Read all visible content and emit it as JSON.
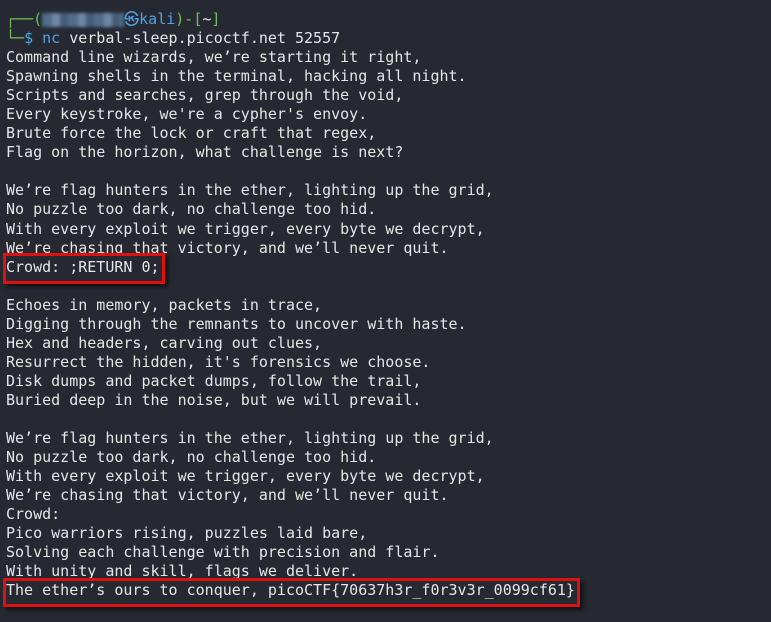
{
  "prompt": {
    "corner_top": "┌──(",
    "user_redacted": true,
    "at_symbol": "㉿",
    "host": "kali",
    "close_paren": ")-[",
    "dir": "~",
    "close_bracket": "]",
    "corner_bottom": "└─",
    "dollar": "$",
    "command": "nc",
    "args": "verbal-sleep.picoctf.net 52557"
  },
  "output_lines": [
    "Command line wizards, we’re starting it right,",
    "Spawning shells in the terminal, hacking all night.",
    "Scripts and searches, grep through the void,",
    "Every keystroke, we're a cypher's envoy.",
    "Brute force the lock or craft that regex,",
    "Flag on the horizon, what challenge is next?",
    "",
    "We’re flag hunters in the ether, lighting up the grid,",
    "No puzzle too dark, no challenge too hid.",
    "With every exploit we trigger, every byte we decrypt,",
    "We’re chasing that victory, and we’ll never quit.",
    "Crowd: ;RETURN 0;",
    "",
    "Echoes in memory, packets in trace,",
    "Digging through the remnants to uncover with haste.",
    "Hex and headers, carving out clues,",
    "Resurrect the hidden, it's forensics we choose.",
    "Disk dumps and packet dumps, follow the trail,",
    "Buried deep in the noise, but we will prevail.",
    "",
    "We’re flag hunters in the ether, lighting up the grid,",
    "No puzzle too dark, no challenge too hid.",
    "With every exploit we trigger, every byte we decrypt,",
    "We’re chasing that victory, and we’ll never quit.",
    "Crowd:",
    "Pico warriors rising, puzzles laid bare,",
    "Solving each challenge with precision and flair.",
    "With unity and skill, flags we deliver.",
    "The ether’s ours to conquer, picoCTF{70637h3r_f0r3v3r_0099cf61}"
  ],
  "highlight_color": "#e01010",
  "highlighted_lines": [
    "Crowd: ;RETURN 0;",
    "The ether’s ours to conquer, picoCTF{70637h3r_f0r3v3r_0099cf61}"
  ]
}
